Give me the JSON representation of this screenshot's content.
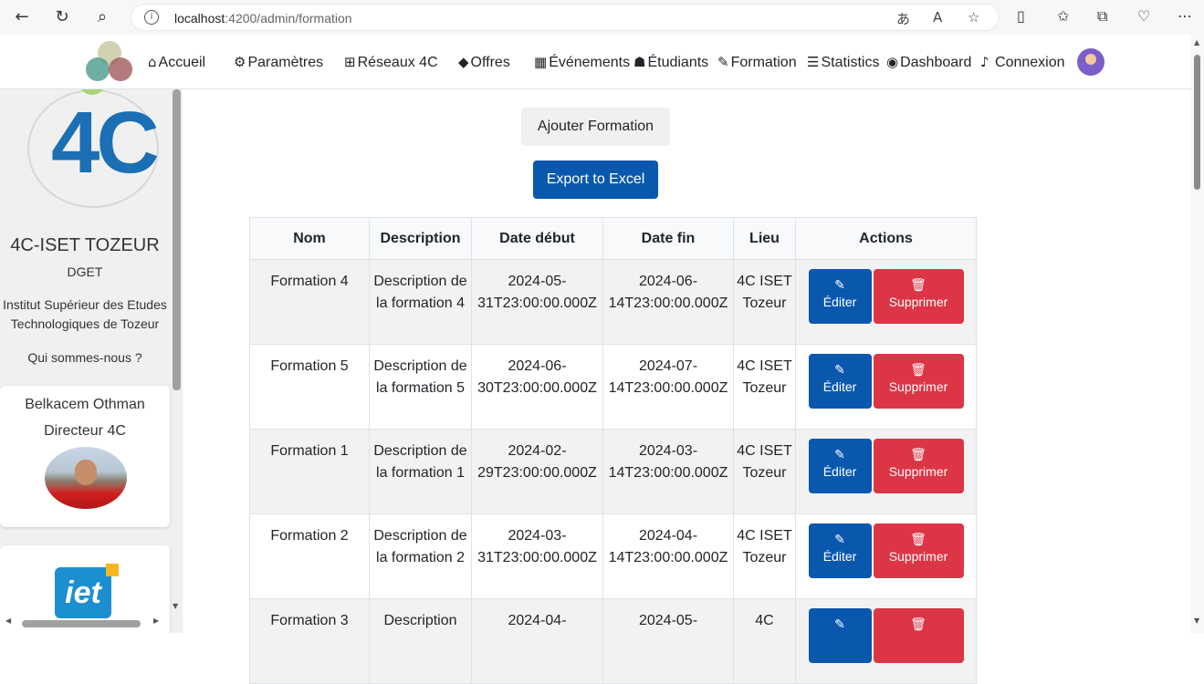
{
  "browser": {
    "url_host": "localhost",
    "url_path": ":4200/admin/formation"
  },
  "navbar": {
    "items": [
      {
        "label": "Accueil",
        "icon": "home-icon"
      },
      {
        "label": "Paramètres",
        "icon": "gear-icon"
      },
      {
        "label": "Réseaux 4C",
        "icon": "network-icon"
      },
      {
        "label": "Offres",
        "icon": "tags-icon"
      },
      {
        "label": "Événements",
        "icon": "calendar-icon"
      },
      {
        "label": "Étudiants",
        "icon": "student-icon"
      },
      {
        "label": "Formation",
        "icon": "edit-icon"
      },
      {
        "label": "Statistics",
        "icon": "chart-icon"
      },
      {
        "label": "Dashboard",
        "icon": "dashboard-icon"
      },
      {
        "label": "Connexion",
        "icon": "bell-icon"
      }
    ]
  },
  "sidebar": {
    "title": "4C-ISET TOZEUR",
    "subtitle": "DGET",
    "institute": "Institut Supérieur des Etudes Technologiques de Tozeur",
    "about": "Qui sommes-nous ?",
    "director_name": "Belkacem Othman",
    "director_role": "Directeur 4C"
  },
  "actions": {
    "add_label": "Ajouter Formation",
    "export_label": "Export to Excel"
  },
  "table": {
    "headers": [
      "Nom",
      "Description",
      "Date début",
      "Date fin",
      "Lieu",
      "Actions"
    ],
    "edit_label": "Éditer",
    "delete_label": "Supprimer",
    "rows": [
      {
        "nom": "Formation 4",
        "description": "Description de la formation 4",
        "debut": "2024-05-31T23:00:00.000Z",
        "fin": "2024-06-14T23:00:00.000Z",
        "lieu": "4C ISET Tozeur"
      },
      {
        "nom": "Formation 5",
        "description": "Description de la formation 5",
        "debut": "2024-06-30T23:00:00.000Z",
        "fin": "2024-07-14T23:00:00.000Z",
        "lieu": "4C ISET Tozeur"
      },
      {
        "nom": "Formation 1",
        "description": "Description de la formation 1",
        "debut": "2024-02-29T23:00:00.000Z",
        "fin": "2024-03-14T23:00:00.000Z",
        "lieu": "4C ISET Tozeur"
      },
      {
        "nom": "Formation 2",
        "description": "Description de la formation 2",
        "debut": "2024-03-31T23:00:00.000Z",
        "fin": "2024-04-14T23:00:00.000Z",
        "lieu": "4C ISET Tozeur"
      },
      {
        "nom": "Formation 3",
        "description": "Description",
        "debut": "2024-04-",
        "fin": "2024-05-",
        "lieu": "4C"
      }
    ]
  }
}
